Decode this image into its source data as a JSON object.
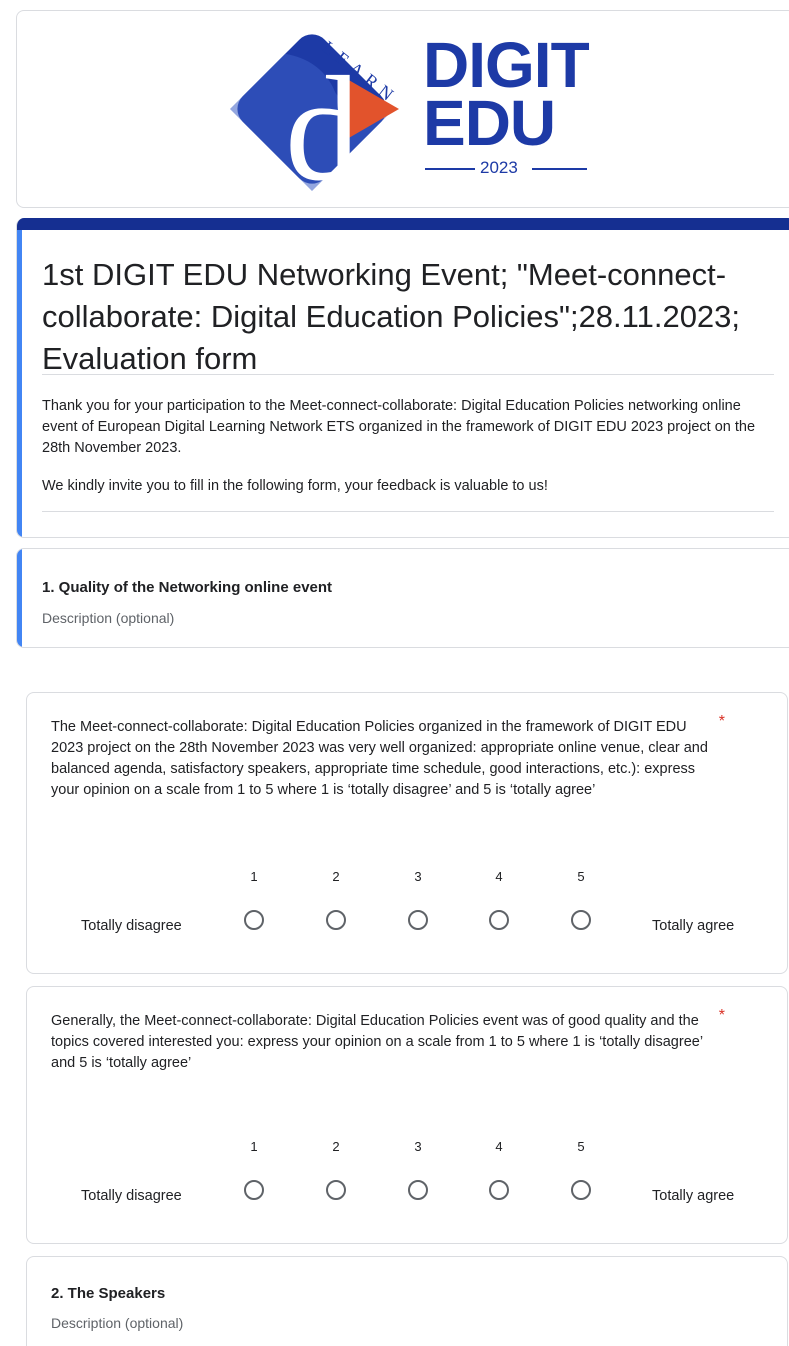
{
  "header": {
    "logo_arc_text": "LEARN",
    "logo_letter": "d",
    "brand_line1": "DIGIT",
    "brand_line2": "EDU",
    "brand_year": "2023",
    "colors": {
      "brand_blue": "#1d3aa6",
      "accent_orange": "#e2532c",
      "light_blue": "#7a9ee0"
    }
  },
  "form": {
    "title": "1st DIGIT EDU Networking Event; \"Meet-connect-collaborate: Digital Education Policies\";28.11.2023; Evaluation form",
    "description_p1": "Thank you for your participation to the Meet-connect-collaborate: Digital Education Policies networking online event of European Digital Learning Network ETS organized in the framework of DIGIT EDU 2023 project on the 28th November 2023.",
    "description_p2": "We kindly invite you to fill in the following form, your feedback is valuable to us!"
  },
  "sections": [
    {
      "title": "1. Quality of the Networking online event",
      "description": "Description (optional)"
    },
    {
      "title": "2. The Speakers",
      "description": "Description (optional)"
    }
  ],
  "questions": [
    {
      "text": "The Meet-connect-collaborate: Digital Education Policies organized in the framework of DIGIT EDU 2023 project on the 28th November 2023 was very well organized: appropriate online venue, clear and balanced agenda, satisfactory speakers, appropriate time schedule, good interactions, etc.): express your opinion on a scale from 1 to 5 where 1 is ‘totally disagree’ and 5 is ‘totally agree’",
      "required_mark": "*",
      "scale": [
        "1",
        "2",
        "3",
        "4",
        "5"
      ],
      "min_label": "Totally disagree",
      "max_label": "Totally agree"
    },
    {
      "text": "Generally, the  Meet-connect-collaborate: Digital Education Policies event was of good quality and the topics covered interested you:  express your opinion on a scale from 1 to 5 where 1 is ‘totally disagree’ and 5 is ‘totally agree’",
      "required_mark": "*",
      "scale": [
        "1",
        "2",
        "3",
        "4",
        "5"
      ],
      "min_label": "Totally disagree",
      "max_label": "Totally agree"
    }
  ]
}
